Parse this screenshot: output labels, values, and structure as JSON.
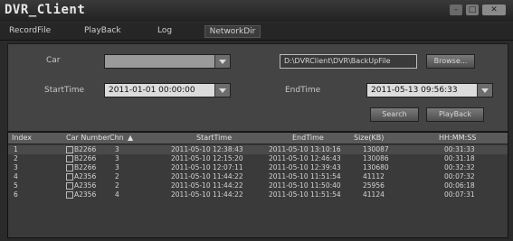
{
  "window": {
    "title": "DVR_Client"
  },
  "menu": {
    "items": [
      "RecordFile",
      "PlayBack",
      "Log",
      "NetworkDir"
    ]
  },
  "form": {
    "car_label": "Car",
    "car_value": "",
    "path_value": "D:\\DVRClient\\DVR\\BackUpFile",
    "browse_label": "Browse...",
    "start_label": "StartTime",
    "start_value": "2011-01-01 00:00:00",
    "end_label": "EndTime",
    "end_value": "2011-05-13 09:56:33",
    "search_label": "Search",
    "playback_label": "PlayBack"
  },
  "table": {
    "headers": [
      "Index",
      "Car Number",
      "Chn",
      "StartTime",
      "EndTime",
      "Size(KB)",
      "HH:MM:SS"
    ],
    "rows": [
      [
        "1",
        "B2266",
        "3",
        "2011-05-10 12:38:43",
        "2011-05-10 13:10:16",
        "130087",
        "00:31:33"
      ],
      [
        "2",
        "B2266",
        "3",
        "2011-05-10 12:15:20",
        "2011-05-10 12:46:43",
        "130086",
        "00:31:18"
      ],
      [
        "3",
        "B2266",
        "3",
        "2011-05-10 12:07:11",
        "2011-05-10 12:39:43",
        "130680",
        "00:32:32"
      ],
      [
        "4",
        "A2356",
        "2",
        "2011-05-10 11:44:22",
        "2011-05-10 11:51:54",
        "41112",
        "00:07:32"
      ],
      [
        "5",
        "A2356",
        "2",
        "2011-05-10 11:44:22",
        "2011-05-10 11:50:40",
        "25956",
        "00:06:18"
      ],
      [
        "6",
        "A2356",
        "4",
        "2011-05-10 11:44:22",
        "2011-05-10 11:51:54",
        "41124",
        "00:07:31"
      ]
    ]
  }
}
